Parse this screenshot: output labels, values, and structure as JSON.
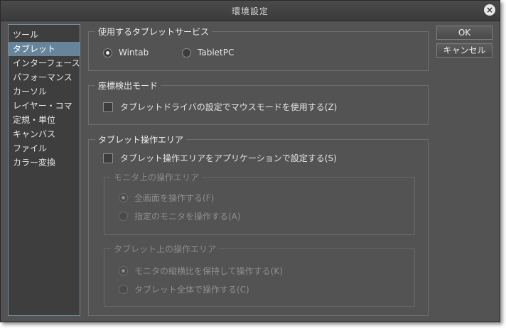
{
  "window": {
    "title": "環境設定"
  },
  "sidebar": {
    "items": [
      {
        "label": "ツール",
        "selected": false
      },
      {
        "label": "タブレット",
        "selected": true
      },
      {
        "label": "インターフェース",
        "selected": false
      },
      {
        "label": "パフォーマンス",
        "selected": false
      },
      {
        "label": "カーソル",
        "selected": false
      },
      {
        "label": "レイヤー・コマ",
        "selected": false
      },
      {
        "label": "定規・単位",
        "selected": false
      },
      {
        "label": "キャンバス",
        "selected": false
      },
      {
        "label": "ファイル",
        "selected": false
      },
      {
        "label": "カラー変換",
        "selected": false
      }
    ]
  },
  "tablet_service": {
    "legend": "使用するタブレットサービス",
    "options": [
      {
        "label": "Wintab",
        "checked": true
      },
      {
        "label": "TabletPC",
        "checked": false
      }
    ]
  },
  "coordinate_mode": {
    "legend": "座標検出モード",
    "checkbox_label": "タブレットドライバの設定でマウスモードを使用する(Z)",
    "checked": false
  },
  "operation_area": {
    "legend": "タブレット操作エリア",
    "checkbox_label": "タブレット操作エリアをアプリケーションで設定する(S)",
    "checked": false,
    "monitor_group": {
      "legend": "モニタ上の操作エリア",
      "options": [
        {
          "label": "全画面を操作する(F)",
          "checked": true
        },
        {
          "label": "指定のモニタを操作する(A)",
          "checked": false
        }
      ]
    },
    "tablet_group": {
      "legend": "タブレット上の操作エリア",
      "options": [
        {
          "label": "モニタの縦横比を保持して操作する(K)",
          "checked": true
        },
        {
          "label": "タブレット全体で操作する(C)",
          "checked": false
        }
      ]
    }
  },
  "buttons": {
    "ok": "OK",
    "cancel": "キャンセル"
  },
  "colors": {
    "panel": "#535353",
    "selection": "#67849a",
    "sidebar_border": "#6e8ea0"
  }
}
